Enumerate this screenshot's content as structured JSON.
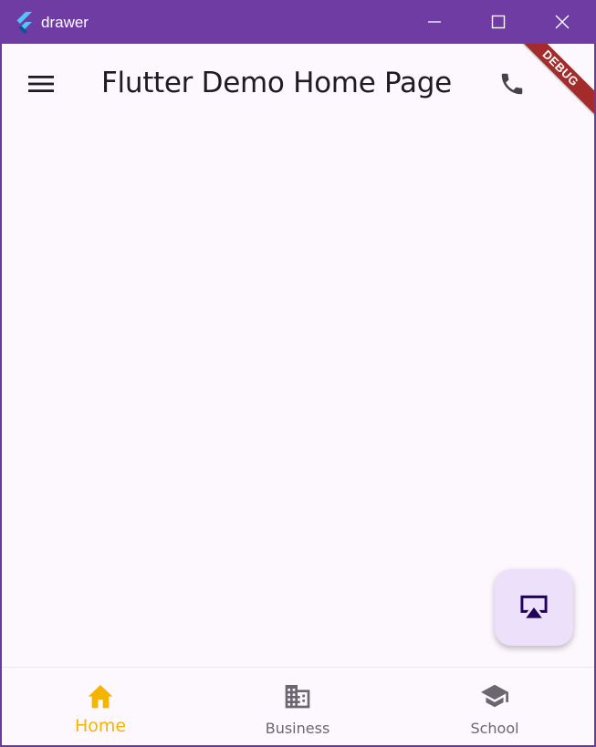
{
  "window": {
    "title": "drawer",
    "controls": {
      "minimize_icon": "minimize-icon",
      "maximize_icon": "maximize-icon",
      "close_icon": "close-icon"
    }
  },
  "appbar": {
    "title": "Flutter Demo Home Page",
    "leading_icon": "menu-icon",
    "action_icon": "phone-icon"
  },
  "debug_banner": {
    "text": "DEBUG",
    "color": "#a52a2a"
  },
  "fab": {
    "icon": "airplay-icon",
    "background": "#ece0fb"
  },
  "bottom_nav": {
    "items": [
      {
        "label": "Home",
        "icon": "home-icon",
        "selected": true
      },
      {
        "label": "Business",
        "icon": "business-icon",
        "selected": false
      },
      {
        "label": "School",
        "icon": "school-icon",
        "selected": false
      }
    ],
    "selected_color": "#f5b400",
    "unselected_color": "#6b6670"
  },
  "colors": {
    "titlebar": "#6f3ca4",
    "background": "#fdf7fe"
  }
}
